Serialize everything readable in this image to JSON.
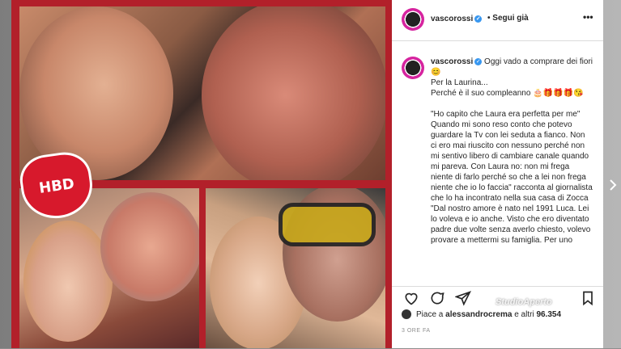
{
  "post": {
    "username": "vascorossi",
    "follow_status": "Segui già",
    "more_label": "•••",
    "photo_badge": "HBD"
  },
  "caption": {
    "username": "vascorossi",
    "first_line": "Oggi vado a comprare dei fiori😊",
    "body": "Per la Laurina...\nPerché è il suo compleanno 🎂🎁🎁🎁😘\n\n\"Ho capito che Laura era perfetta per me\" Quando mi sono reso conto che potevo guardare la Tv con lei seduta a fianco. Non ci ero mai riuscito con nessuno perché non mi sentivo libero di cambiare canale quando mi pareva. Con Laura no: non mi frega niente di farlo perché so che a lei non frega niente che io lo faccia\" racconta al giornalista che lo ha incontrato nella sua casa di Zocca \"Dal nostro amore è nato nel 1991 Luca. Lei lo voleva e io anche. Visto che ero diventato padre due volte senza averlo chiesto, volevo provare a mettermi su famiglia. Per uno"
  },
  "likes": {
    "prefix": "Piace a",
    "user": "alessandrocrema",
    "suffix": "e altri",
    "count": "96.354"
  },
  "time_ago": "3 ORE FA",
  "watermark": "StudioAperto",
  "colors": {
    "frame_red": "#b2202a",
    "verified_blue": "#3897f0",
    "text": "#262626",
    "muted": "#8e8e8e"
  },
  "icons": [
    "heart-icon",
    "comment-icon",
    "share-icon",
    "bookmark-icon",
    "verified-icon",
    "chevron-right-icon"
  ]
}
